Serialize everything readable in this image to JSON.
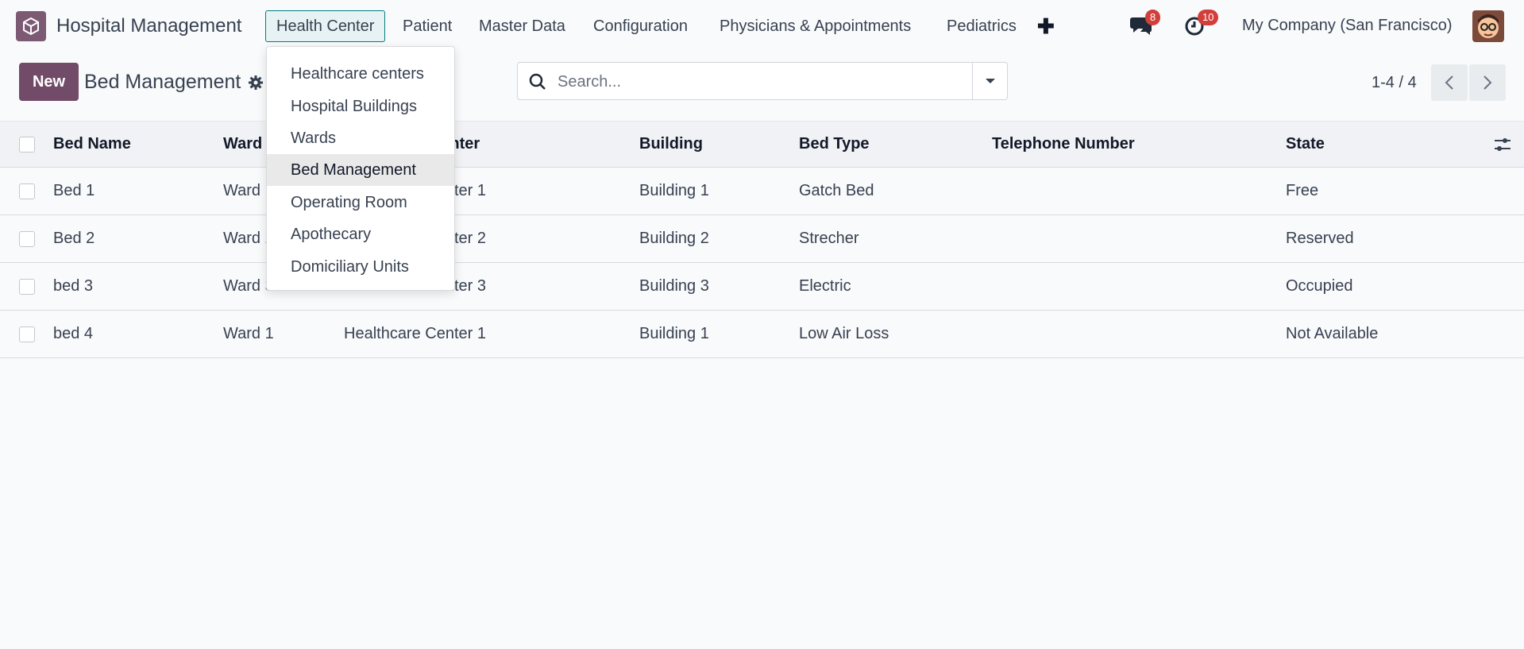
{
  "navbar": {
    "app_name": "Hospital Management",
    "menus": [
      "Health Center",
      "Patient",
      "Master Data",
      "Configuration",
      "Physicians & Appointments",
      "Pediatrics"
    ],
    "messages_count": "8",
    "activities_count": "10",
    "company": "My Company (San Francisco)"
  },
  "control": {
    "new_label": "New",
    "title": "Bed Management",
    "search_placeholder": "Search...",
    "pager": "1-4 / 4"
  },
  "table": {
    "headers": [
      "Bed Name",
      "Ward",
      "Healthcare Center",
      "Building",
      "Bed Type",
      "Telephone Number",
      "State"
    ],
    "rows": [
      {
        "bed_name": "Bed 1",
        "ward": "Ward 1",
        "center": "Healthcare Center 1",
        "building": "Building 1",
        "bed_type": "Gatch Bed",
        "phone": "",
        "state": "Free"
      },
      {
        "bed_name": "Bed 2",
        "ward": "Ward 2",
        "center": "Healthcare Center 2",
        "building": "Building 2",
        "bed_type": "Strecher",
        "phone": "",
        "state": "Reserved"
      },
      {
        "bed_name": "bed 3",
        "ward": "Ward 3",
        "center": "Healthcare Center 3",
        "building": "Building 3",
        "bed_type": "Electric",
        "phone": "",
        "state": "Occupied"
      },
      {
        "bed_name": "bed 4",
        "ward": "Ward 1",
        "center": "Healthcare Center 1",
        "building": "Building 1",
        "bed_type": "Low Air Loss",
        "phone": "",
        "state": "Not Available"
      }
    ]
  },
  "dropdown": {
    "items": [
      "Healthcare centers",
      "Hospital Buildings",
      "Wards",
      "Bed Management",
      "Operating Room",
      "Apothecary",
      "Domiciliary Units"
    ],
    "active": "Bed Management"
  },
  "colors": {
    "brand": "#714b67",
    "active_menu_border": "#017e84",
    "badge": "#d23f3a"
  },
  "icons": [
    "app-logo-icon",
    "plus-icon",
    "chat-icon",
    "clock-icon",
    "gear-icon",
    "search-icon",
    "caret-down-icon",
    "chevron-left-icon",
    "chevron-right-icon",
    "column-settings-icon"
  ]
}
